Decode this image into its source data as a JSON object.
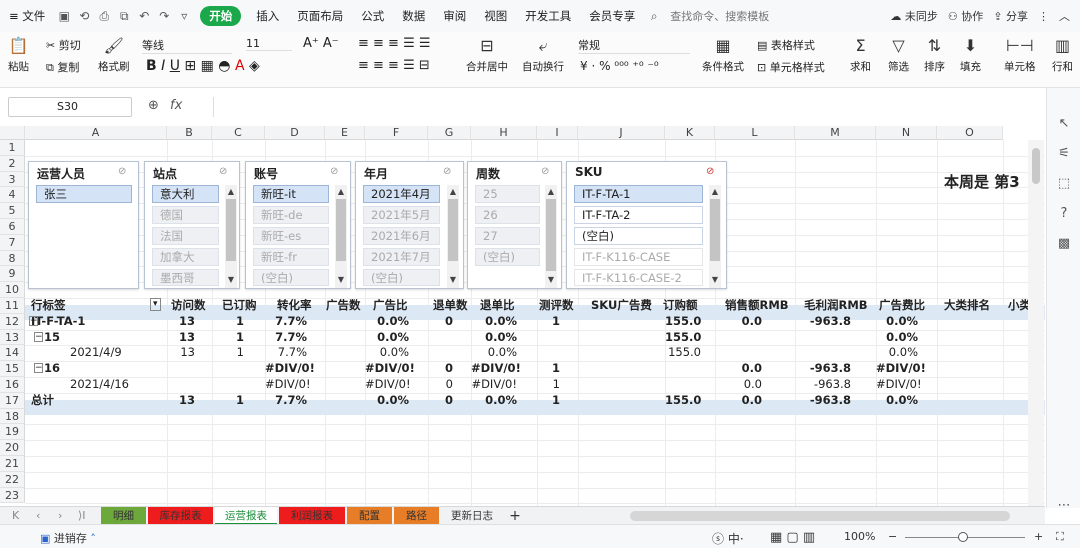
{
  "menubar": {
    "file": "≡ 文件",
    "tabs": [
      "开始",
      "插入",
      "页面布局",
      "公式",
      "数据",
      "审阅",
      "视图",
      "开发工具",
      "会员专享"
    ],
    "search": "查找命令、搜索模板",
    "sync": "未同步",
    "collab": "协作",
    "share": "分享"
  },
  "toolbar": {
    "paste": "粘贴",
    "cut": "剪切",
    "copy": "复制",
    "format_painter": "格式刷",
    "font": "等线",
    "size": "11",
    "number_format": "常规",
    "merge": "合并居中",
    "wrap": "自动换行",
    "conditional": "条件格式",
    "table_style": "表格样式",
    "cell_style": "单元格样式",
    "sum": "求和",
    "filter": "筛选",
    "sort": "排序",
    "fill": "填充",
    "cell": "单元格",
    "rowcol": "行和"
  },
  "formula_bar": {
    "name_box": "S30",
    "fx": "fx",
    "value": ""
  },
  "columns": [
    "A",
    "B",
    "C",
    "D",
    "E",
    "F",
    "G",
    "H",
    "I",
    "J",
    "K",
    "L",
    "M",
    "N",
    "O"
  ],
  "rows": [
    "1",
    "2",
    "3",
    "4",
    "5",
    "6",
    "7",
    "8",
    "9",
    "10",
    "11",
    "12",
    "13",
    "14",
    "15",
    "16",
    "17",
    "18",
    "19",
    "20",
    "21",
    "22",
    "23"
  ],
  "slicers": [
    {
      "title": "运营人员",
      "items": [
        "张三"
      ]
    },
    {
      "title": "站点",
      "items": [
        "意大利",
        "德国",
        "法国",
        "加拿大",
        "墨西哥"
      ]
    },
    {
      "title": "账号",
      "items": [
        "新旺-it",
        "新旺-de",
        "新旺-es",
        "新旺-fr",
        "(空白)"
      ]
    },
    {
      "title": "年月",
      "items": [
        "2021年4月",
        "2021年5月",
        "2021年6月",
        "2021年7月",
        "(空白)"
      ]
    },
    {
      "title": "周数",
      "items": [
        "25",
        "26",
        "27",
        "(空白)"
      ]
    },
    {
      "title": "SKU",
      "items": [
        "IT-F-TA-1",
        "IT-F-TA-2",
        "(空白)",
        "IT-F-K116-CASE",
        "IT-F-K116-CASE-2"
      ]
    }
  ],
  "banner": "本周是 第3",
  "pivot": {
    "headers": [
      "行标签",
      "访问数",
      "已订购",
      "转化率",
      "广告数",
      "广告比",
      "退单数",
      "退单比",
      "测评数",
      "SKU广告费",
      "订购额",
      "销售额RMB",
      "毛利润RMB",
      "广告费比",
      "大类排名",
      "小类"
    ],
    "r12": [
      "IT-F-TA-1",
      "13",
      "1",
      "7.7%",
      "0.0%",
      "0",
      "0.0%",
      "1",
      "155.0",
      "0.0",
      "-963.8",
      "0.0%"
    ],
    "r13": [
      "15",
      "13",
      "1",
      "7.7%",
      "0.0%",
      "0.0%",
      "155.0",
      "0.0%"
    ],
    "r14": [
      "2021/4/9",
      "13",
      "1",
      "7.7%",
      "0.0%",
      "0.0%",
      "155.0",
      "0.0%"
    ],
    "r15": [
      "16",
      "#DIV/0!",
      "#DIV/0!",
      "0",
      "#DIV/0!",
      "1",
      "0.0",
      "-963.8",
      "#DIV/0!"
    ],
    "r16": [
      "2021/4/16",
      "#DIV/0!",
      "#DIV/0!",
      "0",
      "#DIV/0!",
      "1",
      "0.0",
      "-963.8",
      "#DIV/0!"
    ],
    "r17": [
      "总计",
      "13",
      "1",
      "7.7%",
      "0.0%",
      "0",
      "0.0%",
      "1",
      "155.0",
      "0.0",
      "-963.8",
      "0.0%"
    ]
  },
  "sheets": [
    "明细",
    "库存报表",
    "运营报表",
    "利润报表",
    "配置",
    "路径",
    "更新日志",
    "+"
  ],
  "status": {
    "app": "进销存",
    "zoom": "100%"
  }
}
